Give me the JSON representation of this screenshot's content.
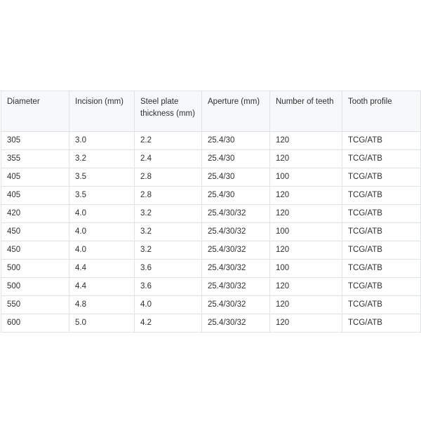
{
  "table": {
    "headers": [
      "Diameter",
      "Incision (mm)",
      "Steel plate thickness (mm)",
      "Aperture (mm)",
      "Number of teeth",
      "Tooth profile"
    ],
    "rows": [
      [
        "305",
        "3.0",
        "2.2",
        "25.4/30",
        "120",
        "TCG/ATB"
      ],
      [
        "355",
        "3.2",
        "2.4",
        "25.4/30",
        "120",
        "TCG/ATB"
      ],
      [
        "405",
        "3.5",
        "2.8",
        "25.4/30",
        "100",
        "TCG/ATB"
      ],
      [
        "405",
        "3.5",
        "2.8",
        "25.4/30",
        "120",
        "TCG/ATB"
      ],
      [
        "420",
        "4.0",
        "3.2",
        "25.4/30/32",
        "120",
        "TCG/ATB"
      ],
      [
        "450",
        "4.0",
        "3.2",
        "25.4/30/32",
        "100",
        "TCG/ATB"
      ],
      [
        "450",
        "4.0",
        "3.2",
        "25.4/30/32",
        "120",
        "TCG/ATB"
      ],
      [
        "500",
        "4.4",
        "3.6",
        "25.4/30/32",
        "100",
        "TCG/ATB"
      ],
      [
        "500",
        "4.4",
        "3.6",
        "25.4/30/32",
        "120",
        "TCG/ATB"
      ],
      [
        "550",
        "4.8",
        "4.0",
        "25.4/30/32",
        "120",
        "TCG/ATB"
      ],
      [
        "600",
        "5.0",
        "4.2",
        "25.4/30/32",
        "120",
        "TCG/ATB"
      ]
    ]
  }
}
